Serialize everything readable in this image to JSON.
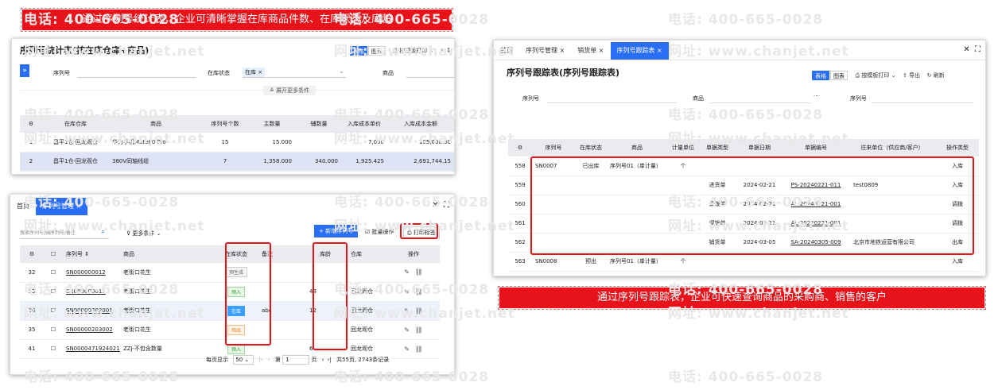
{
  "watermark": {
    "phone": "电话: 400-665-0028",
    "site": "网址: www.chanjet.net"
  },
  "banner_left": "通过序列号统计表，企业可清晰掌握在库商品件数、在库状态及库龄",
  "banner_right": "通过序列号跟踪表，企业可快速查询商品的采购商、销售的客户",
  "p1": {
    "title": "序列号统计表(按在库仓库+商品)",
    "tool_table": "表格",
    "tool_chart": "图表",
    "tool_print": "按模板打印",
    "tool_export": "导",
    "f_serial": "序列号",
    "f_status": "在库状态",
    "f_status_val": "在库",
    "f_goods": "商品",
    "expand": "展开更多条件",
    "cols": [
      "在库仓库",
      "商品",
      "序列号个数",
      "主数量",
      "辅数量",
      "入库成本单价",
      "入库成本金额"
    ],
    "rows": [
      {
        "no": "1",
        "wh": "昌平1仓-回龙观仓",
        "goods": "华为手机Mate60 Pro",
        "cnt": "15",
        "main": "15.000",
        "aux": "",
        "price": "7,000",
        "amt": "105,000.00"
      },
      {
        "no": "2",
        "wh": "昌平1仓-回龙观仓",
        "goods": "380V同轴线缆",
        "cnt": "7",
        "main": "1,358.000",
        "aux": "340.000",
        "price": "1,925.425",
        "amt": "2,691,744.15"
      }
    ]
  },
  "p2": {
    "tab_home": "首页",
    "tab_active": "序列号管理",
    "search_placeholder": "搜索序列号/辅序列号/备注",
    "more": "更多条件",
    "btn_add": "+ 新增序列号",
    "btn_batch": "批量操作",
    "btn_print": "打印标签",
    "cols": [
      "序列号",
      "商品",
      "在库状态",
      "备注",
      "库龄",
      "仓库",
      "操作"
    ],
    "rows": [
      {
        "no": "32",
        "sn": "SN000000012",
        "goods": "老街口花生",
        "status": "预生成",
        "st": "",
        "note": "",
        "age": "",
        "wh": ""
      },
      {
        "no": "33",
        "sn": "SN000000015",
        "goods": "老街口花生",
        "status": "预入",
        "st": "in",
        "note": "",
        "age": "48",
        "wh": "回龙观仓"
      },
      {
        "no": "34",
        "sn": "SN00000203001",
        "goods": "老街口花生",
        "status": "在库",
        "st": "store",
        "note": "abc",
        "age": "12",
        "wh": "回龙观仓"
      },
      {
        "no": "35",
        "sn": "SN00000203002",
        "goods": "老街口花生",
        "status": "预出",
        "st": "out",
        "note": "",
        "age": "",
        "wh": "回龙观仓"
      },
      {
        "no": "41",
        "sn": "SN000047192402100",
        "goods": "ZZJ-不包含数量",
        "status": "预入",
        "st": "in",
        "note": "",
        "age": "6",
        "wh": "回龙观仓"
      }
    ],
    "pager": {
      "per_label": "每页显示",
      "per": "50",
      "page_pre": "第",
      "page": "1",
      "page_post": "页",
      "total": "共55页, 2743条记录"
    }
  },
  "p3": {
    "tabs": [
      "首页",
      "序列号管理",
      "销货单",
      "序列号跟踪表"
    ],
    "title": "序列号跟踪表(序列号跟踪表)",
    "tool_table": "表格",
    "tool_chart": "图表",
    "tool_print": "按模板打印",
    "tool_export": "导出",
    "tool_refresh": "刷新",
    "f_serial": "序列号",
    "f_goods": "商品",
    "f_dots": "···",
    "f_serial2": "序列号",
    "cols": [
      "序列号",
      "在库状态",
      "商品",
      "计量单位",
      "单据类型",
      "单据日期",
      "单据编号",
      "往来单位（供应商/客户）",
      "操作类型"
    ],
    "rows": [
      {
        "no": "558",
        "sn": "SN0007",
        "st": "已出库",
        "goods": "序列号01（单计量）",
        "unit": "个",
        "type": "",
        "date": "",
        "code": "",
        "partner": "",
        "op": "入库"
      },
      {
        "no": "559",
        "sn": "",
        "st": "",
        "goods": "",
        "unit": "",
        "type": "进货单",
        "date": "2024-02-21",
        "code": "PS-20240221-011",
        "partner": "test0809",
        "op": "入库"
      },
      {
        "no": "560",
        "sn": "",
        "st": "",
        "goods": "",
        "unit": "",
        "type": "调拨单",
        "date": "2024-02-21",
        "code": "AL-20240221-001",
        "partner": "",
        "op": "调拨"
      },
      {
        "no": "561",
        "sn": "",
        "st": "",
        "goods": "",
        "unit": "",
        "type": "调拨单",
        "date": "2024-02-21",
        "code": "AL-20240221-001",
        "partner": "",
        "op": "调拨"
      },
      {
        "no": "562",
        "sn": "",
        "st": "",
        "goods": "",
        "unit": "",
        "type": "销货单",
        "date": "2024-03-05",
        "code": "SA-20240305-009",
        "partner": "北京市地铁运营有限公司",
        "op": "出库"
      },
      {
        "no": "563",
        "sn": "SN0008",
        "st": "预出",
        "goods": "序列号01（单计量）",
        "unit": "个",
        "type": "",
        "date": "",
        "code": "",
        "partner": "",
        "op": "入库"
      }
    ]
  }
}
